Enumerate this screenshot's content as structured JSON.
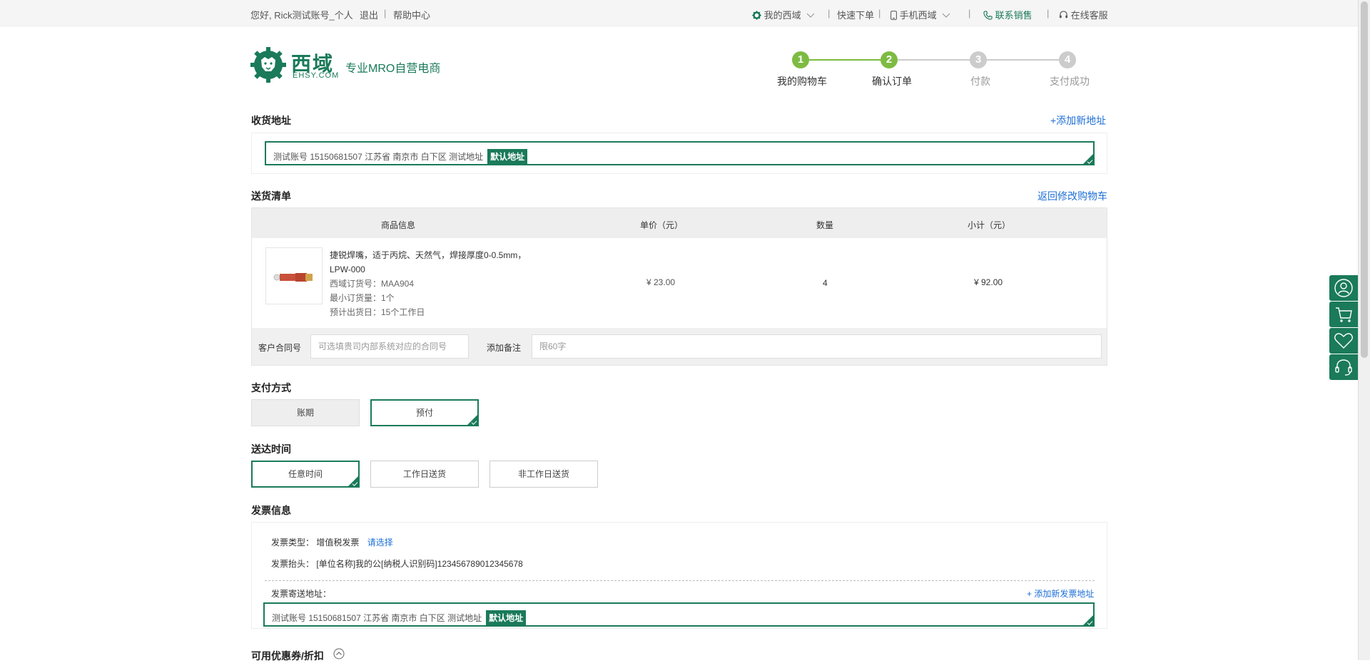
{
  "topbar": {
    "greeting": "您好, Rick测试账号_个人",
    "logout": "退出",
    "help": "帮助中心",
    "my_account": "我的西域",
    "quick_order": "快速下单",
    "mobile": "手机西域",
    "contact_sales": "联系销售",
    "online_service": "在线客服"
  },
  "logo": {
    "name": "西域",
    "domain": "EHSY.COM",
    "slogan": "专业MRO自营电商"
  },
  "steps": [
    {
      "num": "1",
      "label": "我的购物车"
    },
    {
      "num": "2",
      "label": "确认订单"
    },
    {
      "num": "3",
      "label": "付款"
    },
    {
      "num": "4",
      "label": "支付成功"
    }
  ],
  "shipping": {
    "title": "收货地址",
    "add_link": "+添加新地址",
    "address": "测试账号  15150681507  江苏省  南京市  白下区  测试地址",
    "default_badge": "默认地址"
  },
  "delivery_list": {
    "title": "送货清单",
    "back_link": "返回修改购物车",
    "headers": {
      "product": "商品信息",
      "price": "单价（元）",
      "qty": "数量",
      "subtotal": "小计（元）"
    },
    "item": {
      "name_line1": "捷锐焊嘴，适于丙烷、天然气，焊接厚度0-0.5mm，",
      "name_line2": "LPW-000",
      "sku": "西域订货号：MAA904",
      "min_qty": "最小订货量：1个",
      "ship_date": "预计出货日：15个工作日",
      "price": "¥ 23.00",
      "qty": "4",
      "subtotal": "¥ 92.00"
    },
    "contract_label": "客户合同号",
    "contract_placeholder": "可选填贵司内部系统对应的合同号",
    "remark_label": "添加备注",
    "remark_placeholder": "限60字"
  },
  "payment": {
    "title": "支付方式",
    "options": [
      "账期",
      "预付"
    ]
  },
  "delivery_time": {
    "title": "送达时间",
    "options": [
      "任意时间",
      "工作日送货",
      "非工作日送货"
    ]
  },
  "invoice": {
    "title": "发票信息",
    "type_label": "发票类型：",
    "type_value": "增值税发票",
    "choose_link": "请选择",
    "header_label": "发票抬头：",
    "header_value": "[单位名称]我的公[纳税人识别码]123456789012345678",
    "send_addr_label": "发票寄送地址：",
    "add_addr_link": "+ 添加新发票地址",
    "address": "测试账号  15150681507  江苏省  南京市  白下区  测试地址",
    "default_badge": "默认地址"
  },
  "coupon": {
    "title": "可用优惠券/折扣"
  },
  "colors": {
    "brand_green": "#1a7a5a",
    "step_green": "#7dbb42",
    "link_blue": "#1e6fd6"
  }
}
